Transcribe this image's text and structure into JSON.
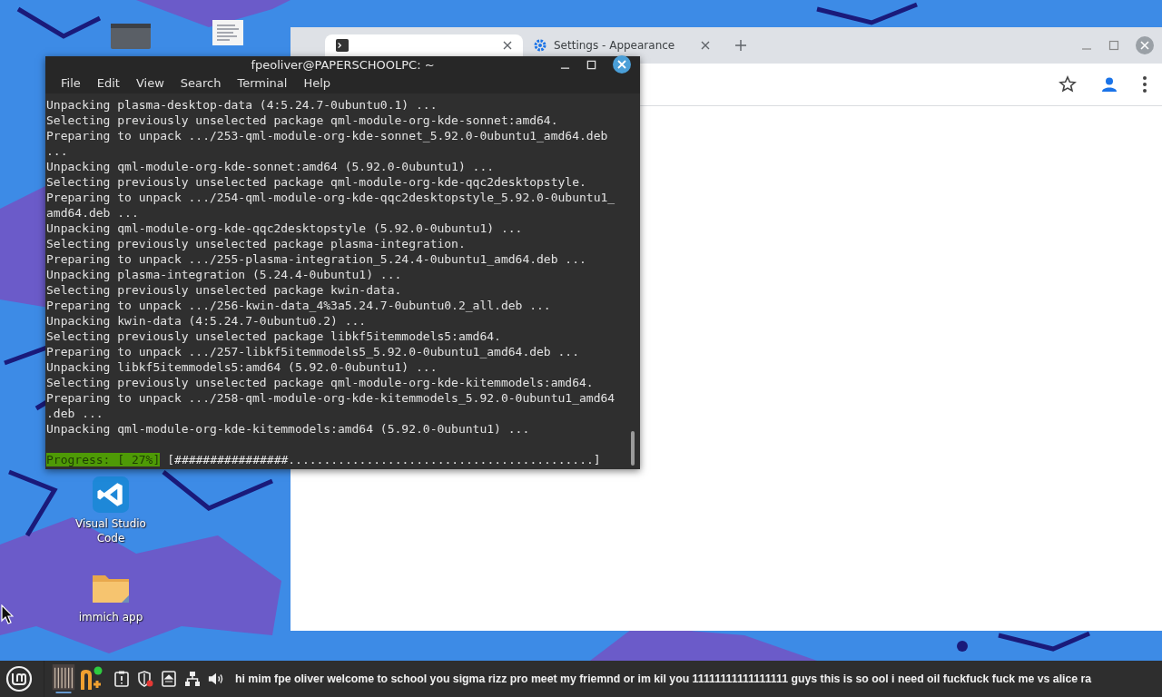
{
  "desktop": {
    "icons": [
      {
        "kind": "window"
      },
      {
        "kind": "document"
      },
      {
        "kind": "vscode",
        "label": "Visual Studio Code"
      },
      {
        "kind": "folder",
        "label": "immich app"
      }
    ]
  },
  "browser": {
    "tabs": [
      {
        "selected": true
      },
      {
        "title": "Settings - Appearance",
        "selected": false
      }
    ]
  },
  "terminal": {
    "title": "fpeoliver@PAPERSCHOOLPC: ~",
    "menu": [
      "File",
      "Edit",
      "View",
      "Search",
      "Terminal",
      "Help"
    ],
    "lines": [
      "Unpacking plasma-desktop-data (4:5.24.7-0ubuntu0.1) ...",
      "Selecting previously unselected package qml-module-org-kde-sonnet:amd64.",
      "Preparing to unpack .../253-qml-module-org-kde-sonnet_5.92.0-0ubuntu1_amd64.deb",
      "...",
      "Unpacking qml-module-org-kde-sonnet:amd64 (5.92.0-0ubuntu1) ...",
      "Selecting previously unselected package qml-module-org-kde-qqc2desktopstyle.",
      "Preparing to unpack .../254-qml-module-org-kde-qqc2desktopstyle_5.92.0-0ubuntu1_",
      "amd64.deb ...",
      "Unpacking qml-module-org-kde-qqc2desktopstyle (5.92.0-0ubuntu1) ...",
      "Selecting previously unselected package plasma-integration.",
      "Preparing to unpack .../255-plasma-integration_5.24.4-0ubuntu1_amd64.deb ...",
      "Unpacking plasma-integration (5.24.4-0ubuntu1) ...",
      "Selecting previously unselected package kwin-data.",
      "Preparing to unpack .../256-kwin-data_4%3a5.24.7-0ubuntu0.2_all.deb ...",
      "Unpacking kwin-data (4:5.24.7-0ubuntu0.2) ...",
      "Selecting previously unselected package libkf5itemmodels5:amd64.",
      "Preparing to unpack .../257-libkf5itemmodels5_5.92.0-0ubuntu1_amd64.deb ...",
      "Unpacking libkf5itemmodels5:amd64 (5.92.0-0ubuntu1) ...",
      "Selecting previously unselected package qml-module-org-kde-kitemmodels:amd64.",
      "Preparing to unpack .../258-qml-module-org-kde-kitemmodels_5.92.0-0ubuntu1_amd64",
      ".deb ...",
      "Unpacking qml-module-org-kde-kitemmodels:amd64 (5.92.0-0ubuntu1) ..."
    ],
    "progress_label": "Progress: [ 27%]",
    "progress_bar": "[################...........................................]"
  },
  "taskbar": {
    "message": "hi mim fpe oliver welcome to school you sigma rizz pro meet my friemnd or im kil you 11111111111111111 guys this is so  ool i need oil fuckfuck fuck me vs alice ra"
  }
}
